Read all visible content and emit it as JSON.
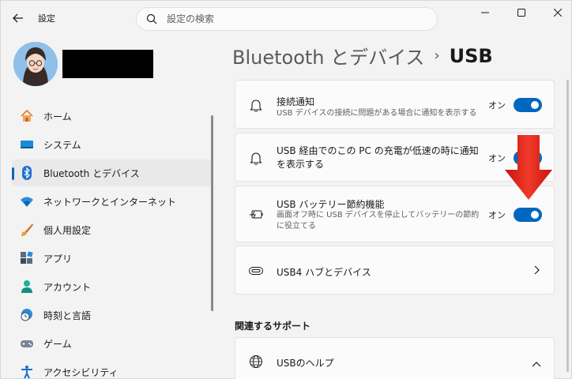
{
  "app": {
    "title": "設定"
  },
  "search": {
    "placeholder": "設定の検索"
  },
  "sidebar": {
    "items": [
      {
        "label": "ホーム",
        "icon": "home-icon"
      },
      {
        "label": "システム",
        "icon": "system-icon"
      },
      {
        "label": "Bluetooth とデバイス",
        "icon": "bluetooth-icon",
        "selected": true
      },
      {
        "label": "ネットワークとインターネット",
        "icon": "wifi-icon"
      },
      {
        "label": "個人用設定",
        "icon": "brush-icon"
      },
      {
        "label": "アプリ",
        "icon": "apps-icon"
      },
      {
        "label": "アカウント",
        "icon": "account-icon"
      },
      {
        "label": "時刻と言語",
        "icon": "globe-clock-icon"
      },
      {
        "label": "ゲーム",
        "icon": "gamepad-icon"
      },
      {
        "label": "アクセシビリティ",
        "icon": "accessibility-icon"
      }
    ]
  },
  "breadcrumb": {
    "parent": "Bluetooth とデバイス",
    "separator": "›",
    "current": "USB"
  },
  "cards": {
    "connection": {
      "title": "接続通知",
      "desc": "USB デバイスの接続に問題がある場合に通知を表示する",
      "toggle_label": "オン"
    },
    "charging": {
      "title": "USB 経由でのこの PC の充電が低速の時に通知を表示する",
      "toggle_label": "オン"
    },
    "battery": {
      "title": "USB バッテリー節約機能",
      "desc": "画面オフ時に USB デバイスを停止してバッテリーの節約に役立てる",
      "toggle_label": "オン"
    },
    "usb4": {
      "title": "USB4 ハブとデバイス"
    }
  },
  "related": {
    "section_title": "関連するサポート",
    "help_title": "USBのヘルプ"
  },
  "colors": {
    "accent": "#0067c0",
    "arrow": "#e8201a"
  }
}
